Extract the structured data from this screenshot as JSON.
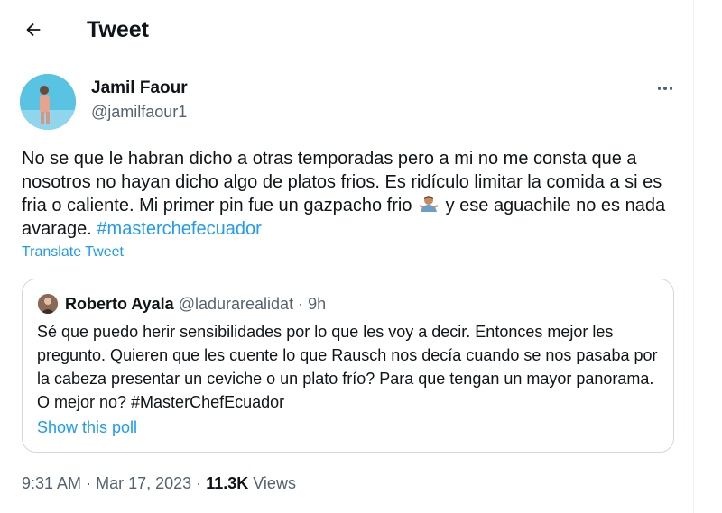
{
  "header": {
    "title": "Tweet",
    "back_icon": "arrow-left-icon"
  },
  "author": {
    "name": "Jamil Faour",
    "handle": "@jamilfaour1"
  },
  "tweet": {
    "text_part1": "No se que le habran dicho a otras temporadas pero a mi no me consta que a nosotros no hayan dicho algo de platos frios. Es ridículo limitar la comida a si es fria o caliente. Mi primer pin fue un gazpacho frio",
    "emoji": "person-shrugging-emoji",
    "text_part2": "y ese aguachile no es nada avarage.",
    "hashtag": "#masterchefecuador",
    "translate_label": "Translate Tweet"
  },
  "quote": {
    "name": "Roberto Ayala",
    "handle": "@ladurarealidat",
    "separator": "·",
    "time": "9h",
    "text": "Sé que puedo herir sensibilidades por lo que les voy a decir. Entonces mejor les pregunto. Quieren que les cuente lo que Rausch nos decía cuando se nos pasaba por la cabeza presentar un ceviche o un plato frío? Para que tengan un mayor panorama. O mejor no?  #MasterChefEcuador",
    "poll_link": "Show this poll"
  },
  "footer": {
    "time": "9:31 AM",
    "dot1": "·",
    "date": "Mar 17, 2023",
    "dot2": "·",
    "views_count": "11.3K",
    "views_label": "Views"
  },
  "colors": {
    "accent": "#1d9bf0",
    "text": "#0f1419",
    "muted": "#536471",
    "border": "#cfd9de"
  }
}
